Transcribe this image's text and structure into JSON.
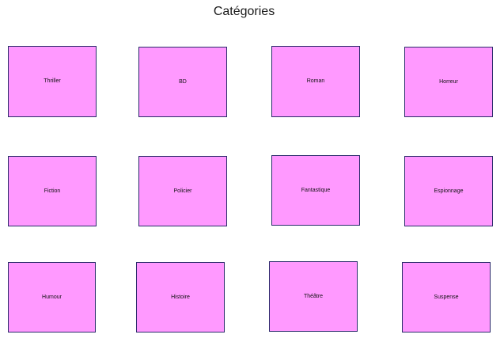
{
  "page": {
    "title": "Catégories"
  },
  "theme": {
    "tile_fill": "#ff99ff",
    "tile_border": "#2b2b6b"
  },
  "categories": [
    {
      "label": "Thriller"
    },
    {
      "label": "BD"
    },
    {
      "label": "Roman"
    },
    {
      "label": "Horreur"
    },
    {
      "label": "Fiction"
    },
    {
      "label": "Policier"
    },
    {
      "label": "Fantastique"
    },
    {
      "label": "Espionnage"
    },
    {
      "label": "Humour"
    },
    {
      "label": "Histoire"
    },
    {
      "label": "Théâtre"
    },
    {
      "label": "Suspense"
    }
  ]
}
